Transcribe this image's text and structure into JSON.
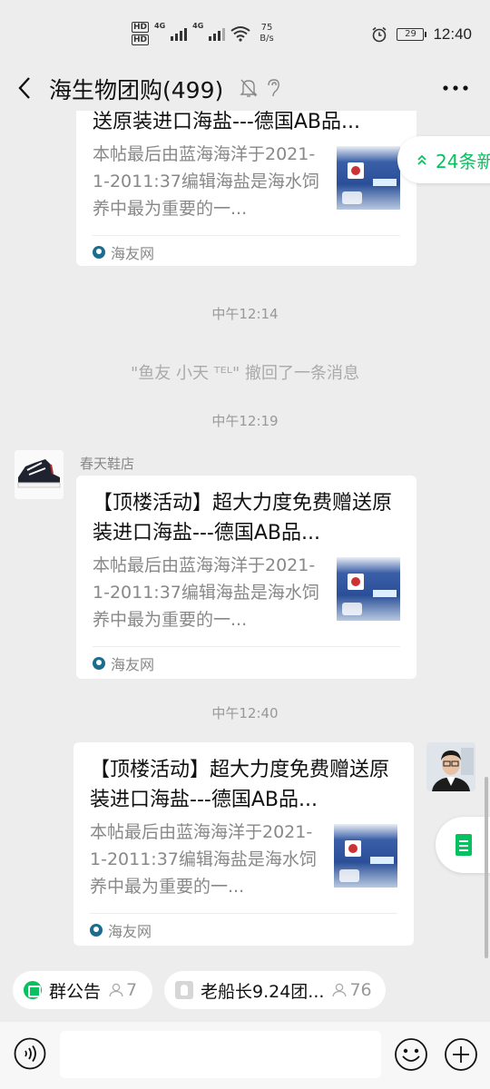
{
  "status_bar": {
    "hd_labels": [
      "HD",
      "HD"
    ],
    "network_labels": [
      "4G",
      "4G"
    ],
    "speed_value": "75",
    "speed_unit": "B/s",
    "battery": "29",
    "time": "12:40"
  },
  "header": {
    "title": "海生物团购(499)"
  },
  "new_messages": {
    "label": "24条新"
  },
  "messages": [
    {
      "title_line2": "送原装进口海盐---德国AB品...",
      "desc": "本帖最后由蓝海海洋于2021-1-2011:37编辑海盐是海水饲养中最为重要的一...",
      "source": "海友网"
    },
    {
      "time": "中午12:14",
      "recall": "\"鱼友 小天 ᵀᴱᴸ\" 撤回了一条消息"
    },
    {
      "time": "中午12:19",
      "sender": "春天鞋店",
      "title": "【顶楼活动】超大力度免费赠送原装进口海盐---德国AB品...",
      "desc": "本帖最后由蓝海海洋于2021-1-2011:37编辑海盐是海水饲养中最为重要的一...",
      "source": "海友网"
    },
    {
      "time": "中午12:40",
      "title": "【顶楼活动】超大力度免费赠送原装进口海盐---德国AB品...",
      "desc": "本帖最后由蓝海海洋于2021-1-2011:37编辑海盐是海水饲养中最为重要的一...",
      "source": "海友网"
    }
  ],
  "chips": {
    "announcement_label": "群公告",
    "announcement_count": "7",
    "group_label": "老船长9.24团...",
    "group_count": "76"
  },
  "input": {
    "value": ""
  },
  "colors": {
    "background": "#ededed",
    "accent": "#07c160",
    "card": "#ffffff",
    "muted_text": "#888888"
  }
}
